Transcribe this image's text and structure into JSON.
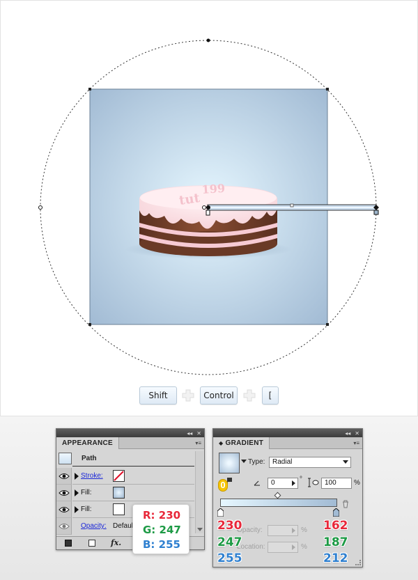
{
  "keys": {
    "shift": "Shift",
    "control": "Control",
    "bracket": "["
  },
  "appearance": {
    "tab": "APPEARANCE",
    "object": "Path",
    "stroke_label": "Stroke:",
    "fill_label_1": "Fill:",
    "fill_label_2": "Fill:",
    "opacity_label": "Opacity:",
    "opacity_value": "Defaul",
    "fx_label": "fx."
  },
  "gradient": {
    "tab": "GRADIENT",
    "type_label": "Type:",
    "type_value": "Radial",
    "angle_value": "0",
    "angle_unit": "°",
    "aspect_value": "100",
    "aspect_unit": "%",
    "opacity_label": "Opacity:",
    "location_label": "Location:",
    "pct": "%",
    "stop_index_badge": "0",
    "left_stop": {
      "r": "230",
      "g": "247",
      "b": "255"
    },
    "right_stop": {
      "r": "162",
      "g": "187",
      "b": "212"
    }
  },
  "callout": {
    "r": "R: 230",
    "g": "G: 247",
    "b": "B: 255"
  },
  "colors": {
    "accent_red": "#e8283a",
    "accent_green": "#1d9a45",
    "accent_blue": "#2f80d0",
    "gradient_start": "#e6f7ff",
    "gradient_end": "#a2bbd4"
  },
  "icons": [
    "eye-icon",
    "trash-icon",
    "plus-icon",
    "fx-icon",
    "collapse-icon",
    "close-icon",
    "panel-menu-icon"
  ]
}
